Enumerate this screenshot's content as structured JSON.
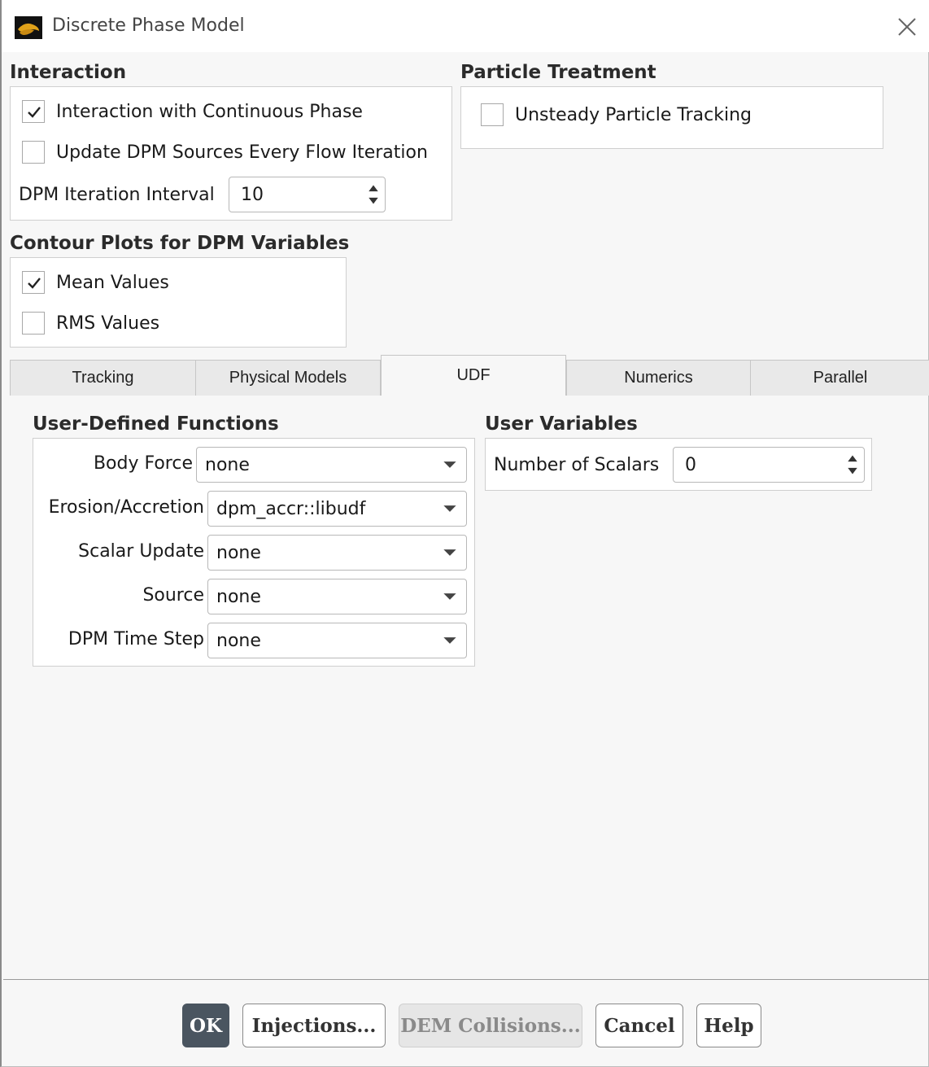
{
  "window": {
    "title": "Discrete Phase Model",
    "close_icon": "close-icon",
    "app_icon": "ansys-fluent-logo-icon"
  },
  "interaction": {
    "title": "Interaction",
    "interaction_with_continuous_phase": {
      "label": "Interaction with Continuous Phase",
      "checked": true
    },
    "update_dpm_sources": {
      "label": "Update DPM Sources Every Flow Iteration",
      "checked": false
    },
    "dpm_iteration_interval": {
      "label": "DPM Iteration Interval",
      "value": "10"
    }
  },
  "particle_treatment": {
    "title": "Particle Treatment",
    "unsteady_particle_tracking": {
      "label": "Unsteady Particle Tracking",
      "checked": false
    }
  },
  "contour_plots": {
    "title": "Contour Plots for DPM Variables",
    "mean_values": {
      "label": "Mean Values",
      "checked": true
    },
    "rms_values": {
      "label": "RMS Values",
      "checked": false
    }
  },
  "tabs": [
    {
      "label": "Tracking",
      "active": false
    },
    {
      "label": "Physical Models",
      "active": false
    },
    {
      "label": "UDF",
      "active": true
    },
    {
      "label": "Numerics",
      "active": false
    },
    {
      "label": "Parallel",
      "active": false
    }
  ],
  "udf": {
    "title": "User-Defined Functions",
    "body_force": {
      "label": "Body Force",
      "value": "none"
    },
    "erosion_accretion": {
      "label": "Erosion/Accretion",
      "value": "dpm_accr::libudf"
    },
    "scalar_update": {
      "label": "Scalar Update",
      "value": "none"
    },
    "source": {
      "label": "Source",
      "value": "none"
    },
    "dpm_time_step": {
      "label": "DPM Time Step",
      "value": "none"
    }
  },
  "user_variables": {
    "title": "User Variables",
    "number_of_scalars": {
      "label": "Number of Scalars",
      "value": "0"
    }
  },
  "buttons": {
    "ok": "OK",
    "injections": "Injections...",
    "dem_collisions": "DEM Collisions...",
    "cancel": "Cancel",
    "help": "Help"
  }
}
